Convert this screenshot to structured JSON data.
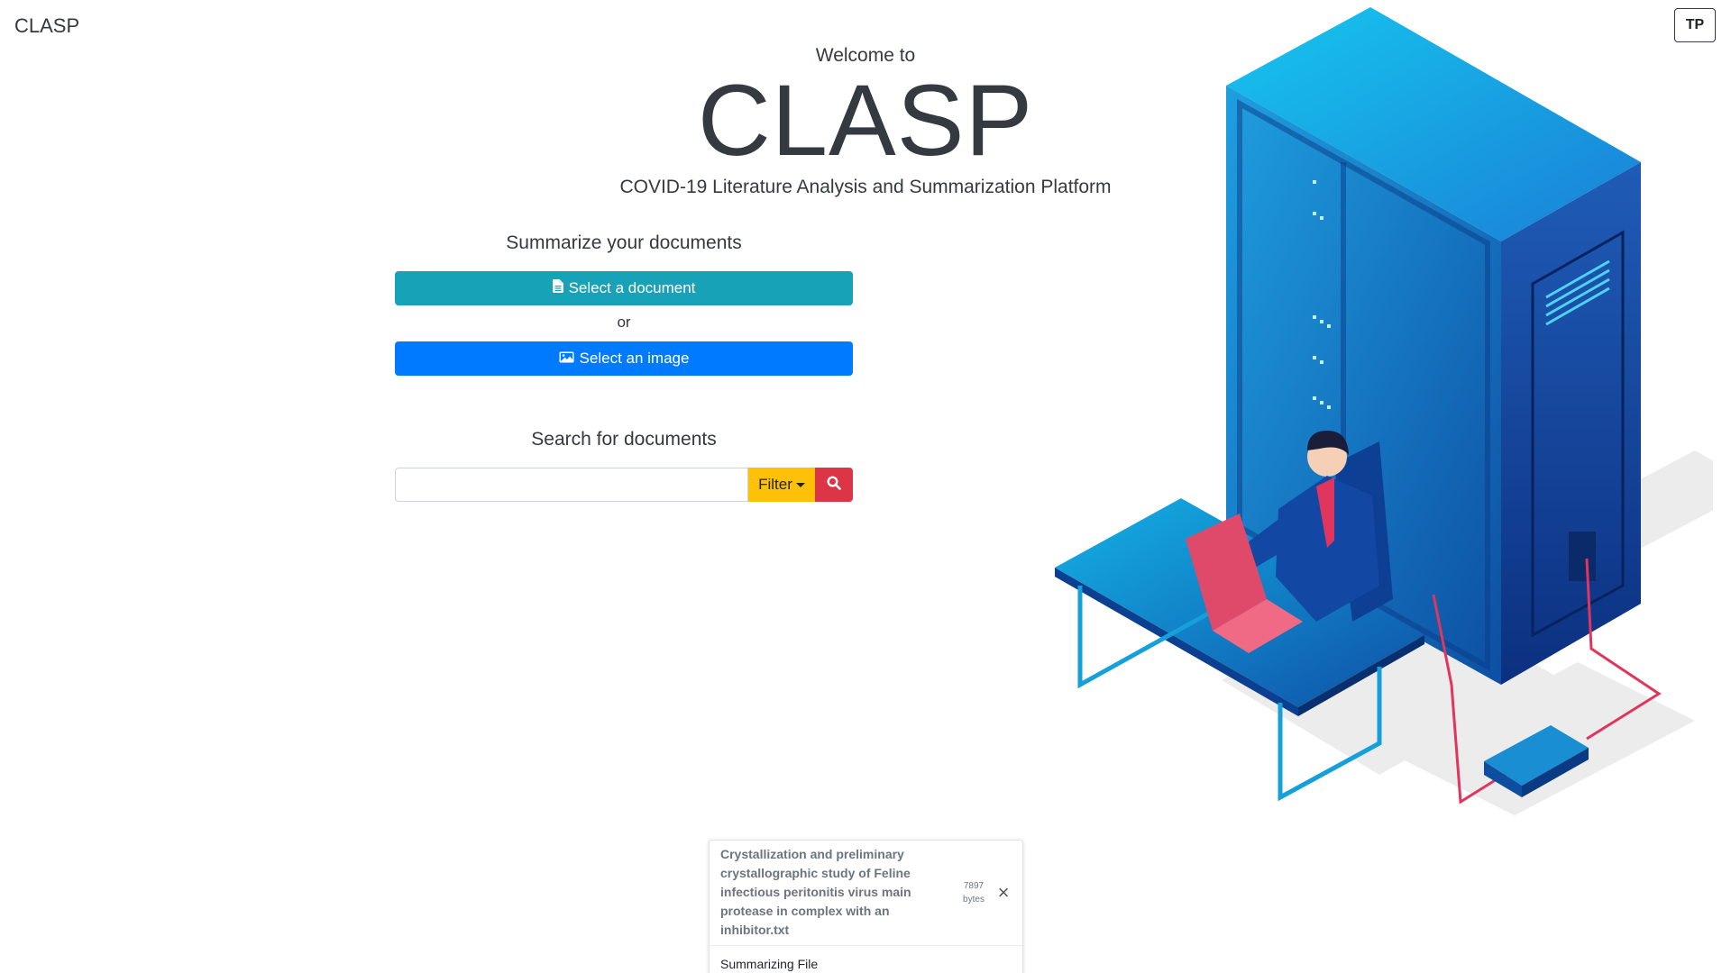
{
  "header": {
    "brand": "CLASP",
    "user_initials": "TP"
  },
  "hero": {
    "welcome": "Welcome to",
    "title": "CLASP",
    "subtitle": "COVID-19 Literature Analysis and Summarization Platform"
  },
  "summarize": {
    "heading": "Summarize your documents",
    "select_document_label": "Select a document",
    "or_label": "or",
    "select_image_label": "Select an image",
    "icons": {
      "document": "file-icon",
      "image": "image-icon"
    }
  },
  "search": {
    "heading": "Search for documents",
    "input_value": "",
    "filter_label": "Filter",
    "search_icon": "search-icon"
  },
  "upload_toast": {
    "file_name": "Crystallization and preliminary crystallographic study of Feline infectious peritonitis virus main protease in complex with an inhibitor.txt",
    "size_value": "7897",
    "size_unit": "bytes",
    "status": "Summarizing File",
    "close_icon": "close-icon"
  },
  "colors": {
    "document_button": "#17a2b8",
    "image_button": "#007bff",
    "filter_button": "#ffc107",
    "search_button": "#dc3545"
  }
}
